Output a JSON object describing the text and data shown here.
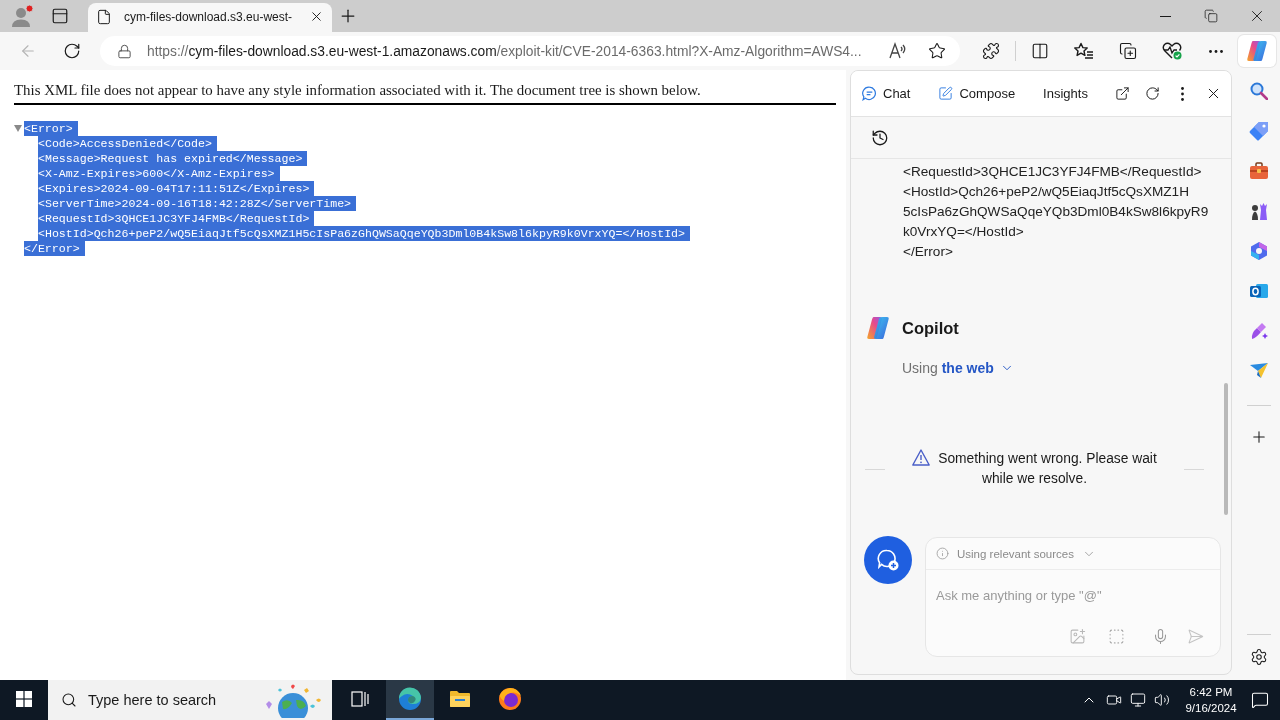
{
  "browser": {
    "profile": {
      "notification": true
    },
    "tabs": [
      {
        "title": "cym-files-download.s3.eu-west-",
        "selected": true
      }
    ],
    "back_disabled": true,
    "address": {
      "scheme": "https://",
      "host": "cym-files-download.s3.eu-west-1.amazonaws.com",
      "rest": "/exploit-kit/CVE-2014-6363.html?X-Amz-Algorithm=AWS4..."
    }
  },
  "page": {
    "notice": "This XML file does not appear to have any style information associated with it. The document tree is shown below.",
    "tree": {
      "expanded": true,
      "highlighted": true,
      "open_tag": "<Error>",
      "children": [
        "<Code>AccessDenied</Code>",
        "<Message>Request has expired</Message>",
        "<X-Amz-Expires>600</X-Amz-Expires>",
        "<Expires>2024-09-04T17:11:51Z</Expires>",
        "<ServerTime>2024-09-16T18:42:28Z</ServerTime>",
        "<RequestId>3QHCE1JC3YFJ4FMB</RequestId>",
        "<HostId>Qch26+peP2/wQ5EiaqJtf5cQsXMZ1H5cIsPa6zGhQWSaQqeYQb3Dml0B4kSw8l6kpyR9k0VrxYQ=</HostId>"
      ],
      "close_tag": "</Error>"
    }
  },
  "sidebar": {
    "tabs": [
      {
        "kind": "chat",
        "label": "Chat"
      },
      {
        "kind": "compose",
        "label": "Compose"
      },
      {
        "kind": "insights",
        "label": "Insights"
      }
    ],
    "message_lines": [
      "<RequestId>3QHCE1JC3YFJ4FMB</RequestId>",
      "<HostId>Qch26+peP2/wQ5EiaqJtf5cQsXMZ1H",
      "5cIsPa6zGhQWSaQqeYQb3Dml0B4kSw8l6kpyR9",
      "k0VrxYQ=</HostId>",
      "</Error>"
    ],
    "assistant": {
      "name": "Copilot",
      "mode_label": "Using",
      "mode": "the web"
    },
    "error": "Something went wrong. Please wait while we resolve.",
    "composer": {
      "sources": "Using relevant sources",
      "placeholder": "Ask me anything or type \"@\""
    }
  },
  "taskbar": {
    "search": {
      "label": "Type here to search"
    },
    "apps": [
      {
        "kind": "task-view",
        "selected": false
      },
      {
        "kind": "edge",
        "selected": true
      },
      {
        "kind": "explorer",
        "selected": false
      },
      {
        "kind": "firefox",
        "selected": false
      }
    ],
    "clock": {
      "time": "6:42 PM",
      "date": "9/16/2024"
    }
  }
}
